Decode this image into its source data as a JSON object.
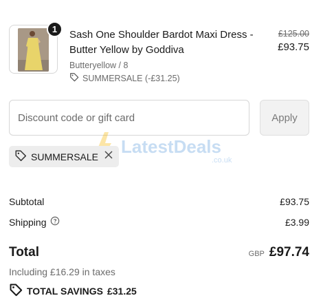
{
  "line_item": {
    "quantity": "1",
    "title": "Sash One Shoulder Bardot Maxi Dress - Butter Yellow by Goddiva",
    "variant": "Butteryellow / 8",
    "discount_applied": "SUMMERSALE (-£31.25)",
    "original_price": "£125.00",
    "price": "£93.75"
  },
  "discount": {
    "placeholder": "Discount code or gift card",
    "apply_label": "Apply",
    "applied_code": "SUMMERSALE"
  },
  "watermark": {
    "brand": "LatestDeals",
    "domain": ".co.uk"
  },
  "summary": {
    "subtotal_label": "Subtotal",
    "subtotal_value": "£93.75",
    "shipping_label": "Shipping",
    "shipping_value": "£3.99",
    "total_label": "Total",
    "currency": "GBP",
    "total_value": "£97.74",
    "taxes_text": "Including £16.29 in taxes",
    "savings_label": "TOTAL SAVINGS",
    "savings_value": "£31.25"
  },
  "icons": {
    "tag": "tag-icon",
    "close": "close-icon",
    "help": "help-circle-icon"
  },
  "colors": {
    "text": "#1a1a1a",
    "muted": "#6b6b6b",
    "border": "#d6d6d6",
    "chip_bg": "#ededed",
    "product_yellow": "#e8d46a"
  }
}
